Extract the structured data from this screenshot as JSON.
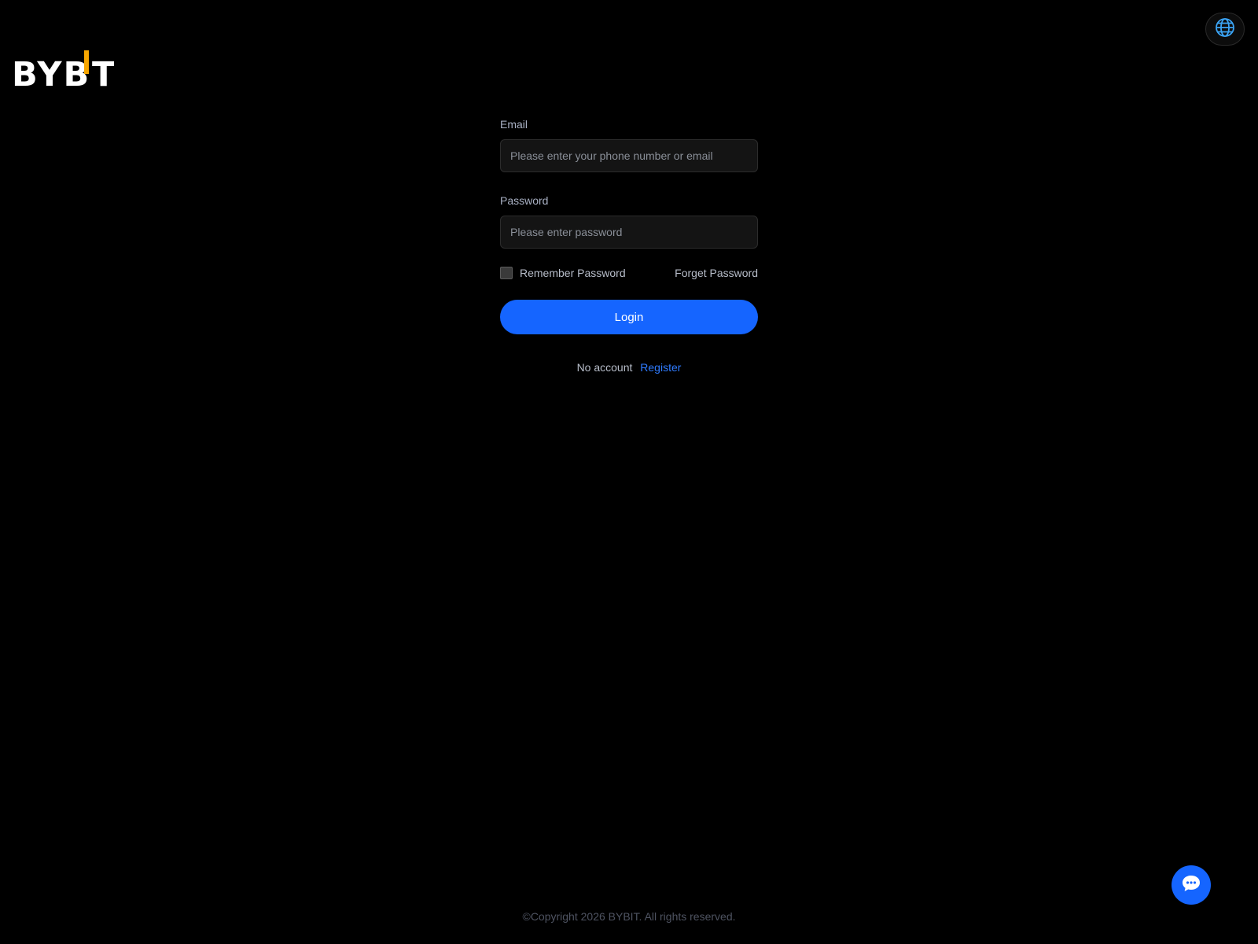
{
  "brand": {
    "logo_text": "BYBIT",
    "accent_color": "#f7a600"
  },
  "header": {
    "language_icon": "globe-icon"
  },
  "form": {
    "email_label": "Email",
    "email_placeholder": "Please enter your phone number or email",
    "email_value": "",
    "password_label": "Password",
    "password_placeholder": "Please enter password",
    "password_value": "",
    "remember_label": "Remember Password",
    "remember_checked": false,
    "forget_label": "Forget Password",
    "login_label": "Login",
    "no_account_text": "No account",
    "register_label": "Register"
  },
  "chat": {
    "icon": "chat-bubble-icon"
  },
  "footer": {
    "copyright": "©Copyright 2026 BYBIT. All rights reserved."
  },
  "colors": {
    "background": "#000000",
    "primary": "#1565ff",
    "link": "#2f7bff"
  }
}
